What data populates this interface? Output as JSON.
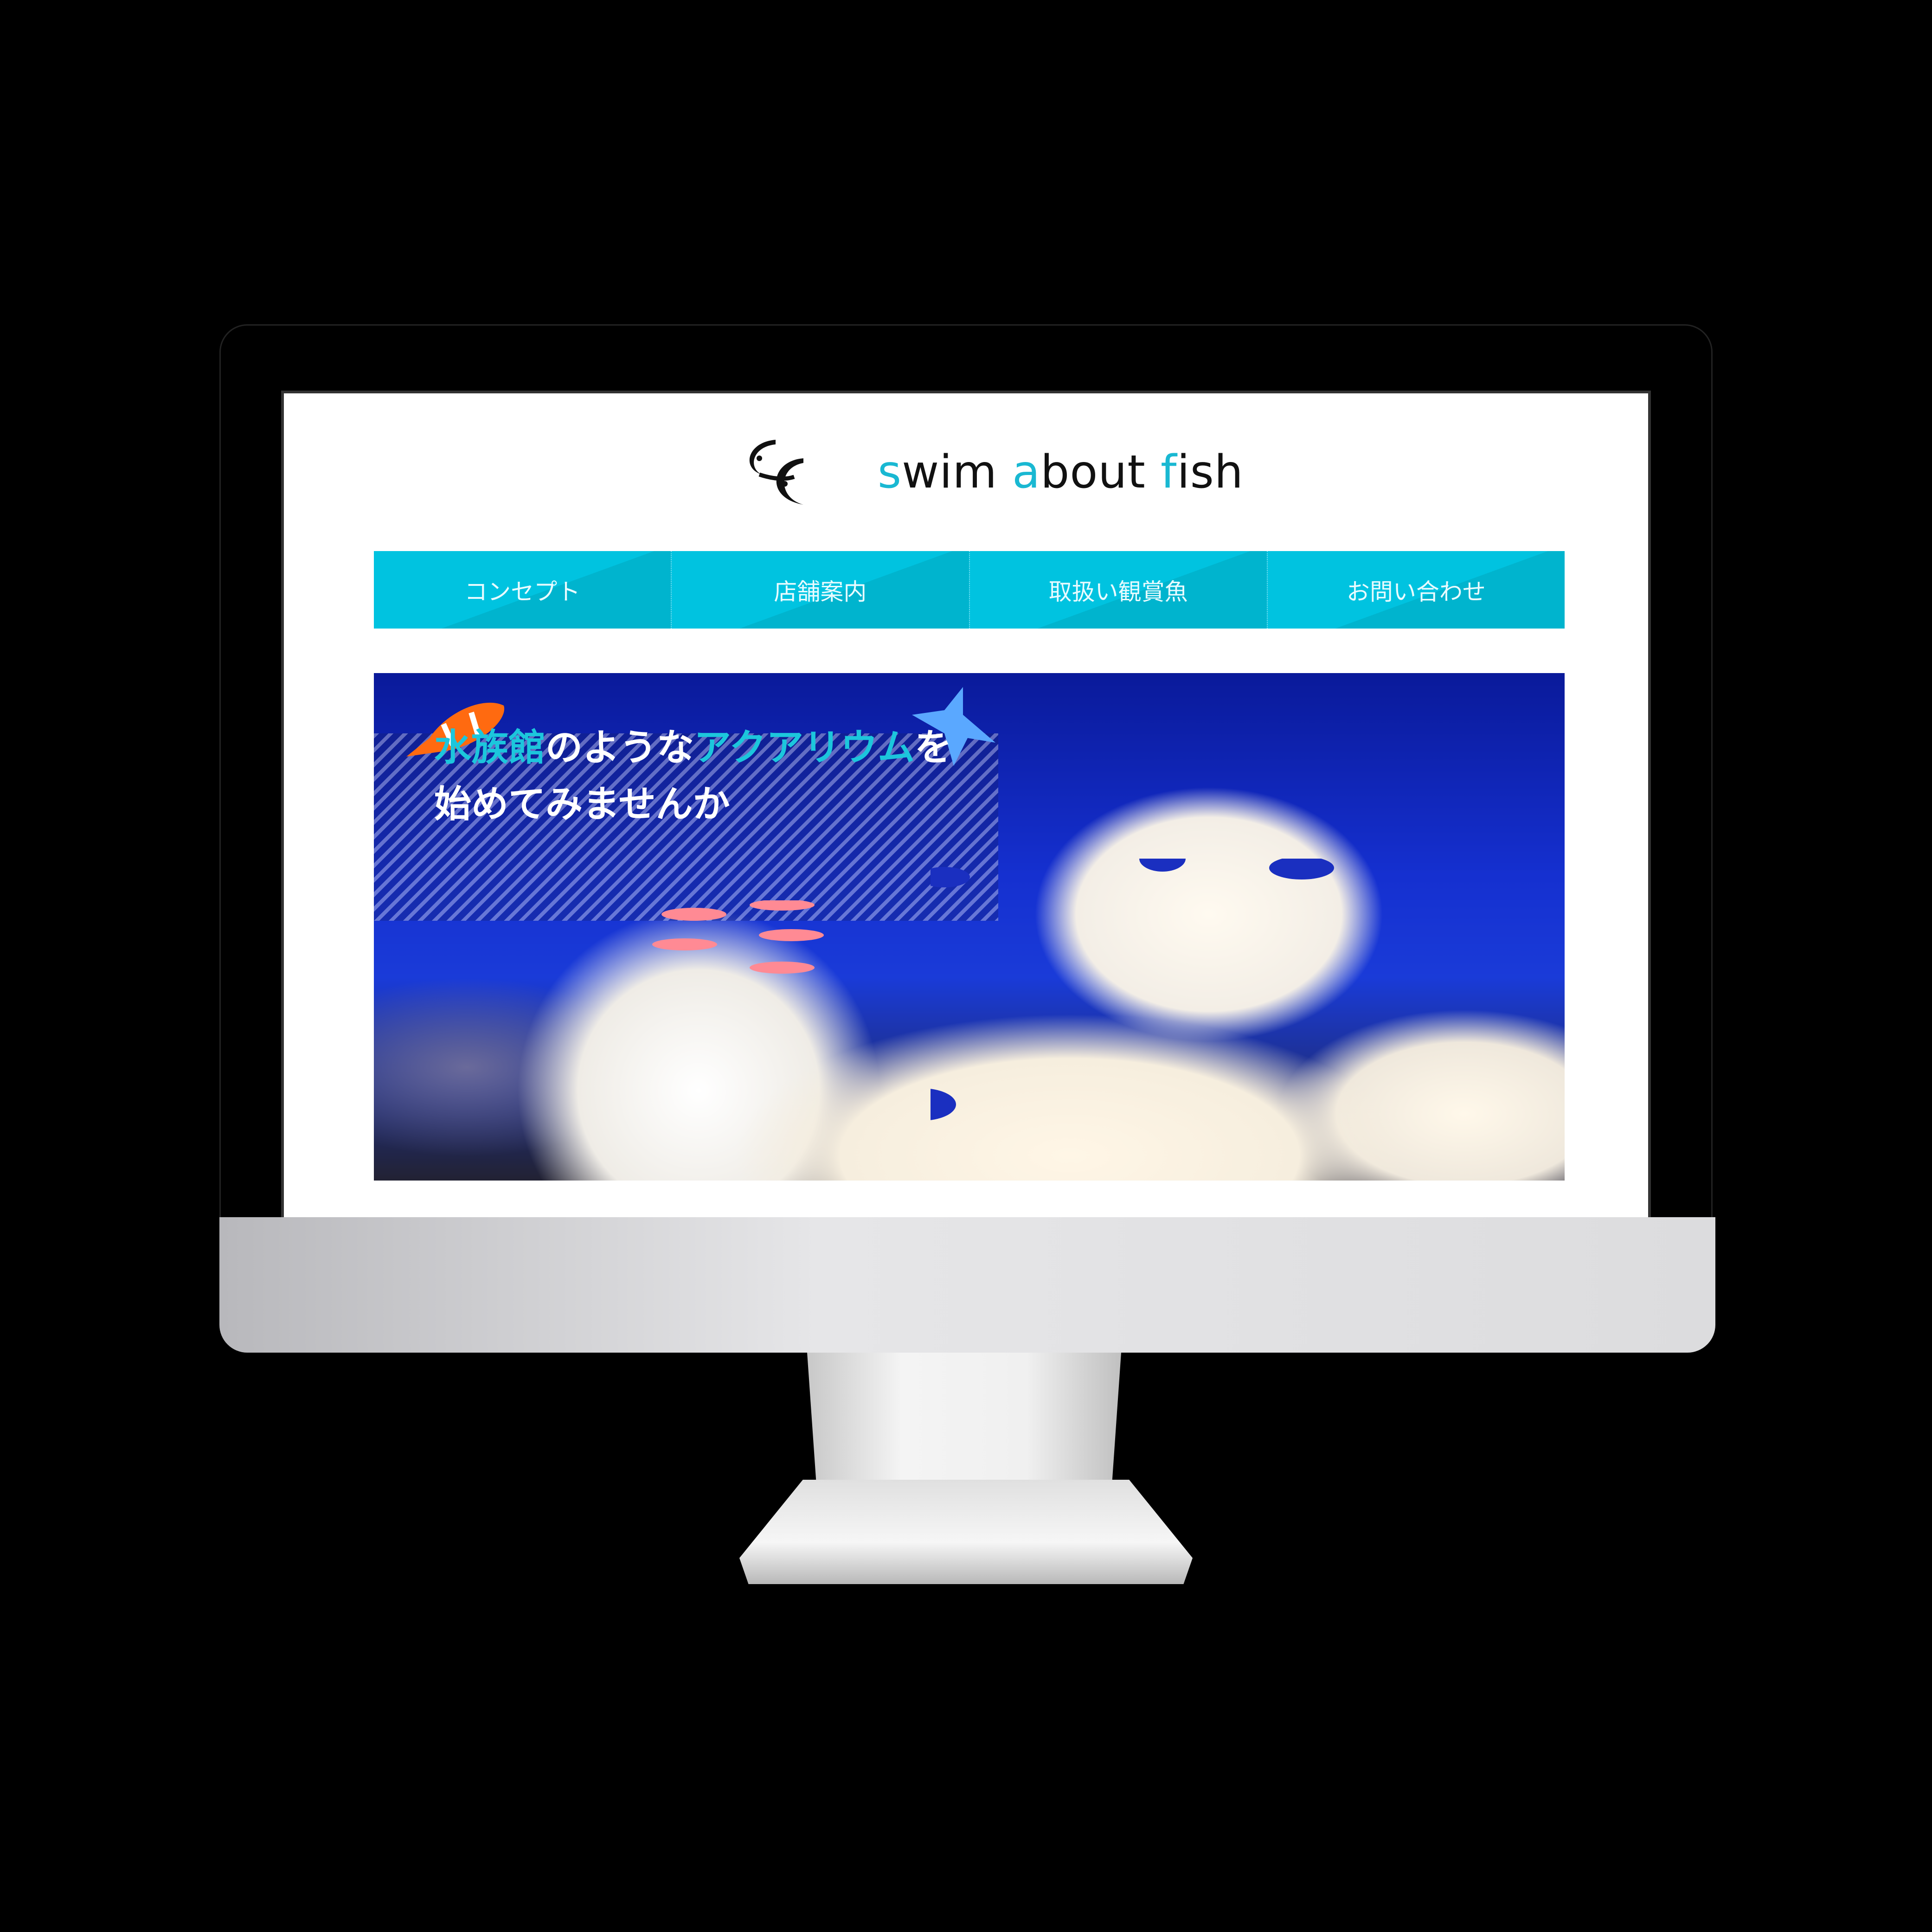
{
  "logo": {
    "text_parts": [
      "s",
      "wim ",
      "a",
      "bout ",
      "f",
      "ish"
    ],
    "brand_accent": "#19b8d2"
  },
  "nav": {
    "items": [
      {
        "label": "コンセプト"
      },
      {
        "label": "店舗案内"
      },
      {
        "label": "取扱い観賞魚"
      },
      {
        "label": "お問い合わせ"
      }
    ],
    "color": "#00c3e0"
  },
  "hero": {
    "line1": [
      {
        "text": "水族館",
        "accent": true
      },
      {
        "text": "のような",
        "accent": false
      },
      {
        "text": "アクアリウム",
        "accent": true
      },
      {
        "text": "を",
        "accent": false
      }
    ],
    "line2": "始めてみませんか"
  }
}
